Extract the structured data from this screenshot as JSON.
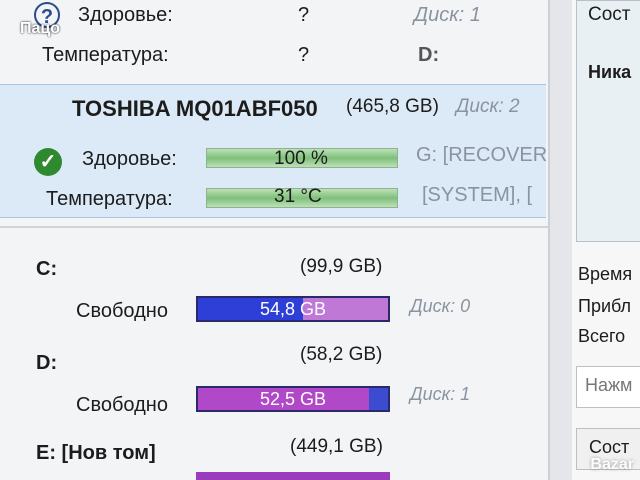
{
  "disk1": {
    "health_label": "Здоровье:",
    "health_value": "?",
    "disk_label": "Диск: 1",
    "temp_label": "Температура:",
    "temp_value": "?",
    "letter": "D:"
  },
  "disk2": {
    "model": "TOSHIBA MQ01ABF050",
    "size": "(465,8 GB)",
    "disk_label": "Диск: 2",
    "health_label": "Здоровье:",
    "health_value": "100 %",
    "health_fraction": 1.0,
    "temp_label": "Температура:",
    "temp_value": "31 °C",
    "partition1": "G: [RECOVER",
    "partition2": "[SYSTEM], ["
  },
  "volumes": [
    {
      "letter": "C:",
      "size": "(99,9 GB)",
      "free_label": "Свободно",
      "free_value": "54,8 GB",
      "free_fraction": 0.55,
      "disk_label": "Диск: 0"
    },
    {
      "letter": "D:",
      "size": "(58,2 GB)",
      "free_label": "Свободно",
      "free_value": "52,5 GB",
      "free_fraction": 0.9,
      "disk_label": "Диск: 1"
    },
    {
      "letter": "E: [Нов том]",
      "size": "(449,1 GB)"
    }
  ],
  "right_panel": {
    "status_top": "Сост",
    "nika": "Ника",
    "time": "Время",
    "approx": "Прибл",
    "total": "Всего",
    "press_button": "Нажм",
    "status_button": "Сост"
  },
  "overlay": {
    "watermark": "Пацо",
    "brand": "Bazar"
  },
  "colors": {
    "health_bar": "#7ec07a",
    "c_fill": "#2d3fd6",
    "d_fill": "#b048c8"
  }
}
